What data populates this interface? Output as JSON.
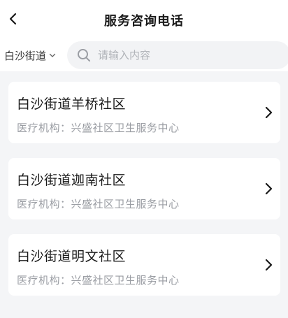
{
  "header": {
    "title": "服务咨询电话",
    "back_icon": "chevron-left-icon"
  },
  "filter": {
    "district_label": "白沙街道",
    "district_icon": "chevron-down-icon",
    "search_placeholder": "请输入内容",
    "search_value": "",
    "search_icon": "search-icon"
  },
  "communities": [
    {
      "name": "白沙街道羊桥社区",
      "org": "医疗机构：兴盛社区卫生服务中心"
    },
    {
      "name": "白沙街道迦南社区",
      "org": "医疗机构：兴盛社区卫生服务中心"
    },
    {
      "name": "白沙街道明文社区",
      "org": "医疗机构：兴盛社区卫生服务中心"
    }
  ],
  "colors": {
    "background": "#f4f5f7",
    "card": "#ffffff",
    "text_primary": "#1a1a1a",
    "text_secondary": "#9a9da3",
    "search_bg": "#f2f3f5"
  }
}
